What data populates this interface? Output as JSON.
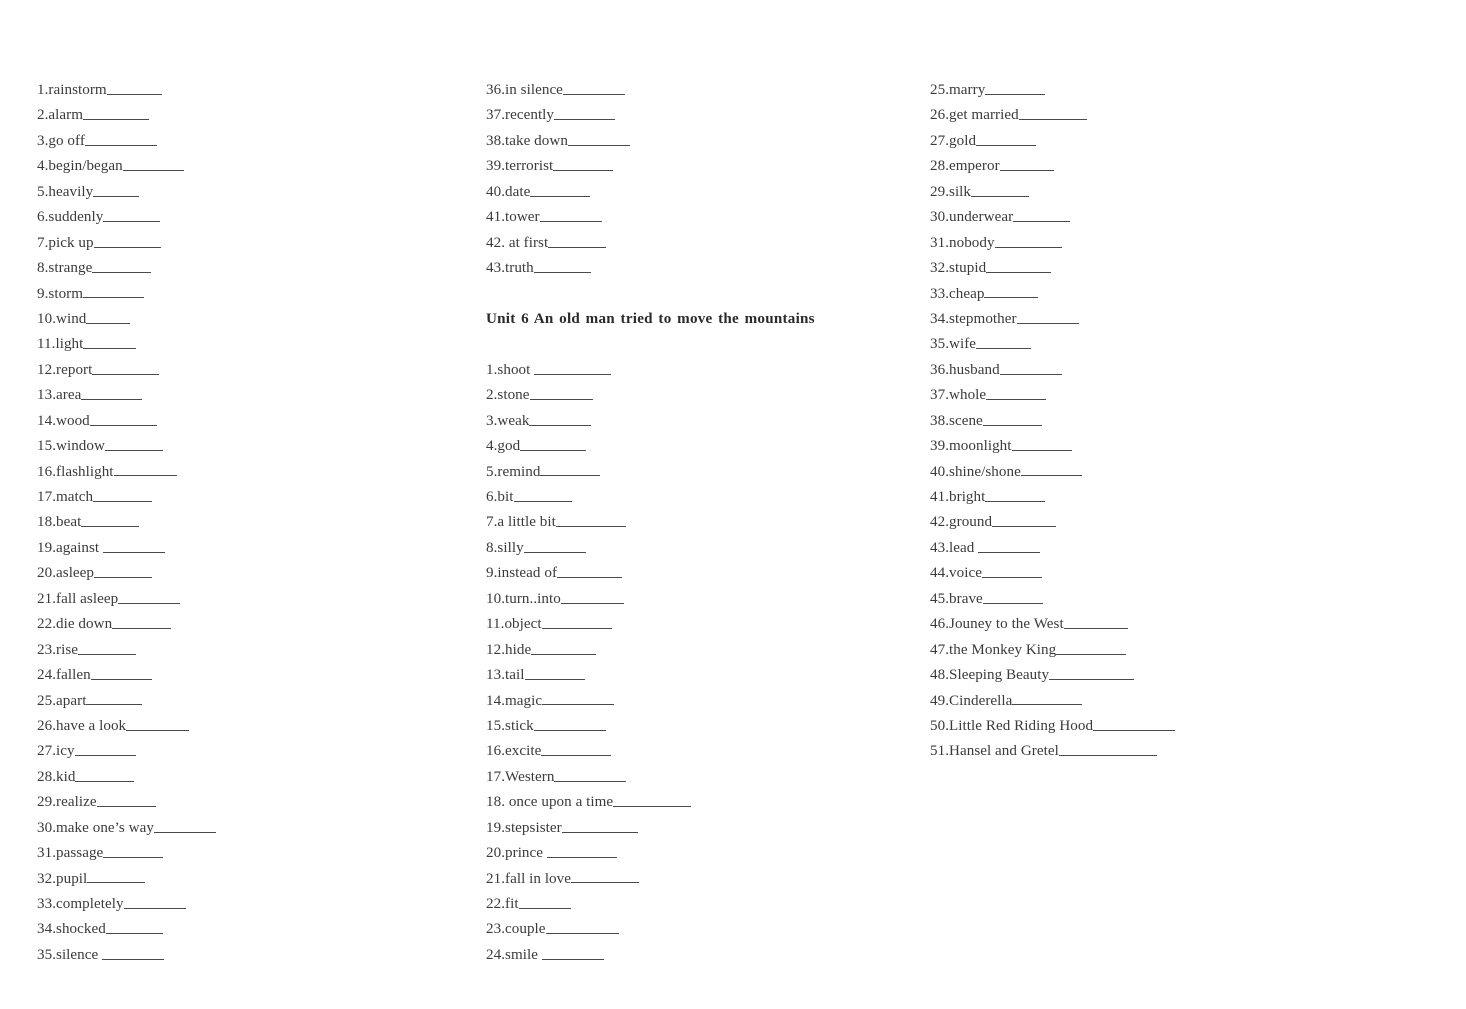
{
  "document": {
    "type": "vocabulary-worksheet",
    "background_color": "#ffffff",
    "text_color": "#3b3b3b",
    "rule_color": "#4a4a4a"
  },
  "headings": {
    "unit6": "Unit 6 An old man tried to move the mountains"
  },
  "columns": [
    {
      "id": "column-1",
      "entries": [
        {
          "term": "1.rainstorm",
          "blank": 55
        },
        {
          "term": "2.alarm",
          "blank": 66
        },
        {
          "term": "3.go off",
          "blank": 72
        },
        {
          "term": "4.begin/began",
          "blank": 61
        },
        {
          "term": "5.heavily",
          "blank": 46
        },
        {
          "term": "6.suddenly",
          "blank": 57
        },
        {
          "term": "7.pick up",
          "blank": 67
        },
        {
          "term": "8.strange",
          "blank": 59
        },
        {
          "term": "9.storm",
          "blank": 61
        },
        {
          "term": "10.wind",
          "blank": 44
        },
        {
          "term": "11.light",
          "blank": 53
        },
        {
          "term": "12.report",
          "blank": 67
        },
        {
          "term": "13.area",
          "blank": 61
        },
        {
          "term": "14.wood",
          "blank": 67
        },
        {
          "term": "15.window",
          "blank": 58
        },
        {
          "term": "16.flashlight",
          "blank": 63
        },
        {
          "term": "17.match",
          "blank": 59
        },
        {
          "term": "18.beat",
          "blank": 58
        },
        {
          "term": "19.against ",
          "blank": 62
        },
        {
          "term": "20.asleep",
          "blank": 58
        },
        {
          "term": "21.fall asleep",
          "blank": 62
        },
        {
          "term": "22.die down",
          "blank": 59
        },
        {
          "term": "23.rise",
          "blank": 58
        },
        {
          "term": "24.fallen",
          "blank": 61
        },
        {
          "term": "25.apart",
          "blank": 56
        },
        {
          "term": "26.have a look",
          "blank": 63
        },
        {
          "term": "27.icy",
          "blank": 61
        },
        {
          "term": "28.kid",
          "blank": 59
        },
        {
          "term": "29.realize",
          "blank": 59
        },
        {
          "term": "30.make one’s way",
          "blank": 62
        },
        {
          "term": "31.passage",
          "blank": 60
        },
        {
          "term": "32.pupil",
          "blank": 58
        },
        {
          "term": "33.completely",
          "blank": 62
        },
        {
          "term": "34.shocked",
          "blank": 57
        },
        {
          "term": "35.silence ",
          "blank": 62
        }
      ]
    },
    {
      "id": "column-2",
      "entries": [
        {
          "term": "36.in silence",
          "blank": 62
        },
        {
          "term": "37.recently",
          "blank": 61
        },
        {
          "term": "38.take down",
          "blank": 62
        },
        {
          "term": "39.terrorist",
          "blank": 60
        },
        {
          "term": "40.date",
          "blank": 60
        },
        {
          "term": "41.tower",
          "blank": 62
        },
        {
          "term": "42. at first",
          "blank": 58
        },
        {
          "term": "43.truth",
          "blank": 57
        }
      ],
      "heading_after": "unit6",
      "entries2": [
        {
          "term": "1.shoot ",
          "blank": 77
        },
        {
          "term": "2.stone",
          "blank": 63
        },
        {
          "term": "3.weak",
          "blank": 62
        },
        {
          "term": "4.god",
          "blank": 66
        },
        {
          "term": "5.remind",
          "blank": 60
        },
        {
          "term": "6.bit",
          "blank": 58
        },
        {
          "term": "7.a little bit",
          "blank": 70
        },
        {
          "term": "8.silly",
          "blank": 62
        },
        {
          "term": "9.instead of",
          "blank": 65
        },
        {
          "term": "10.turn..into",
          "blank": 63
        },
        {
          "term": "11.object",
          "blank": 70
        },
        {
          "term": "12.hide",
          "blank": 65
        },
        {
          "term": "13.tail",
          "blank": 60
        },
        {
          "term": "14.magic",
          "blank": 72
        },
        {
          "term": "15.stick",
          "blank": 72
        },
        {
          "term": "16.excite",
          "blank": 70
        },
        {
          "term": "17.Western",
          "blank": 72
        },
        {
          "term": "18. once upon a time",
          "blank": 78
        },
        {
          "term": "19.stepsister",
          "blank": 76
        },
        {
          "term": "20.prince ",
          "blank": 70
        },
        {
          "term": "21.fall in love",
          "blank": 68
        },
        {
          "term": "22.fit",
          "blank": 52
        },
        {
          "term": "23.couple",
          "blank": 73
        },
        {
          "term": "24.smile ",
          "blank": 62
        }
      ]
    },
    {
      "id": "column-3",
      "entries": [
        {
          "term": "25.marry",
          "blank": 60
        },
        {
          "term": "26.get married",
          "blank": 68
        },
        {
          "term": "27.gold",
          "blank": 60
        },
        {
          "term": "28.emperor",
          "blank": 54
        },
        {
          "term": "29.silk",
          "blank": 58
        },
        {
          "term": "30.underwear",
          "blank": 57
        },
        {
          "term": "31.nobody",
          "blank": 67
        },
        {
          "term": "32.stupid",
          "blank": 65
        },
        {
          "term": "33.cheap",
          "blank": 54
        },
        {
          "term": "34.stepmother",
          "blank": 62
        },
        {
          "term": "35.wife",
          "blank": 55
        },
        {
          "term": "36.husband",
          "blank": 62
        },
        {
          "term": "37.whole",
          "blank": 60
        },
        {
          "term": "38.scene",
          "blank": 59
        },
        {
          "term": "39.moonlight",
          "blank": 60
        },
        {
          "term": "40.shine/shone",
          "blank": 61
        },
        {
          "term": "41.bright",
          "blank": 60
        },
        {
          "term": "42.ground",
          "blank": 64
        },
        {
          "term": "43.lead ",
          "blank": 62
        },
        {
          "term": "44.voice",
          "blank": 60
        },
        {
          "term": "45.brave",
          "blank": 60
        },
        {
          "term": "46.Jouney to the West",
          "blank": 64
        },
        {
          "term": "47.the Monkey King",
          "blank": 70
        },
        {
          "term": "48.Sleeping Beauty",
          "blank": 85
        },
        {
          "term": "49.Cinderella",
          "blank": 70
        },
        {
          "term": "50.Little Red Riding Hood",
          "blank": 82
        },
        {
          "term": "51.Hansel and Gretel",
          "blank": 98
        }
      ]
    }
  ]
}
